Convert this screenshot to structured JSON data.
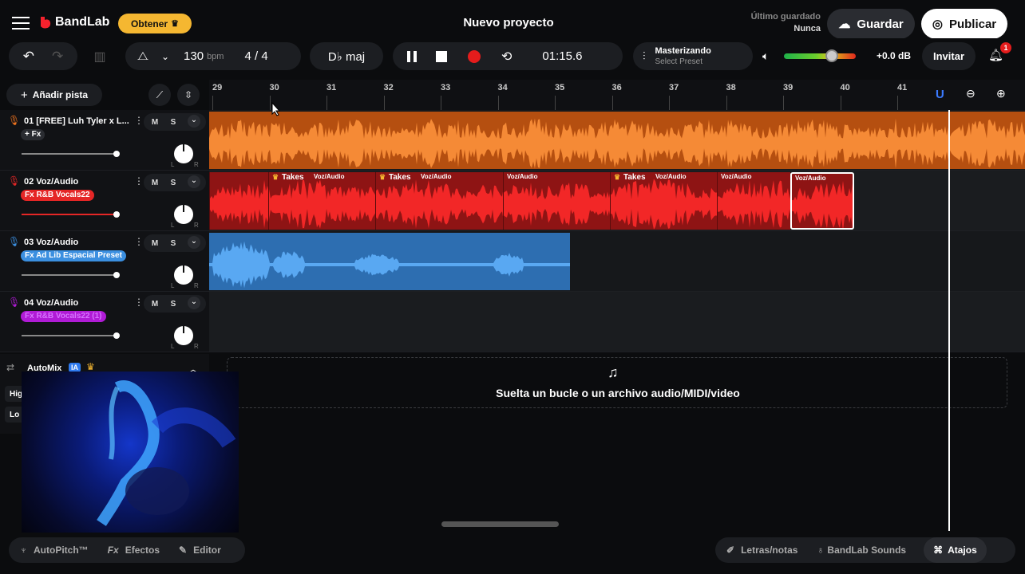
{
  "header": {
    "brand": "BandLab",
    "get_label": "Obtener",
    "project_title": "Nuevo proyecto",
    "last_saved_label": "Último guardado",
    "last_saved_value": "Nunca",
    "save_label": "Guardar",
    "publish_label": "Publicar"
  },
  "toolbar": {
    "tempo_value": "130",
    "tempo_unit": "bpm",
    "time_signature": "4 / 4",
    "key": "D♭ maj",
    "time": "01:15.6",
    "mastering_title": "Masterizando",
    "mastering_preset": "Select Preset",
    "volume_db": "+0.0 dB",
    "invite_label": "Invitar",
    "notification_count": "1"
  },
  "tracklist": {
    "add_track_label": "Añadir pista",
    "mute_label": "M",
    "solo_label": "S",
    "pan_left": "L",
    "pan_right": "R",
    "tracks": [
      {
        "name": "01  [FREE] Luh Tyler x L...",
        "fx": "+ Fx",
        "color": "#f0731e"
      },
      {
        "name": "02  Voz/Audio",
        "fx": "Fx R&B Vocals22",
        "color": "#e52626"
      },
      {
        "name": "03  Voz/Audio",
        "fx": "Fx Ad Lib Espacial Preset",
        "color": "#3b8fe0"
      },
      {
        "name": "04  Voz/Audio",
        "fx": "Fx R&B Vocals22 (1)",
        "color": "#b01bd6"
      }
    ],
    "automix_label": "AutoMix",
    "automix_badge": "IA",
    "automix_row1": "Hig",
    "automix_row2": "Lo"
  },
  "timeline": {
    "bars": [
      "29",
      "30",
      "31",
      "32",
      "33",
      "34",
      "35",
      "36",
      "37",
      "38",
      "39",
      "40",
      "41"
    ],
    "clip_labels": {
      "takes": "Takes",
      "voz": "Voz/Audio"
    },
    "drop_zone_text": "Suelta un bucle o un archivo audio/MIDI/video"
  },
  "footer": {
    "autopitch_label": "AutoPitch™",
    "effects_label": "Efectos",
    "editor_label": "Editor",
    "lyrics_label": "Letras/notas",
    "sounds_label": "BandLab Sounds",
    "shortcuts_label": "Atajos"
  },
  "colors": {
    "orange_track": "#f0731e",
    "red_track": "#e52626",
    "blue_track": "#3b8fe0",
    "purple_track": "#b01bd6",
    "accent_yellow": "#f5b731"
  }
}
